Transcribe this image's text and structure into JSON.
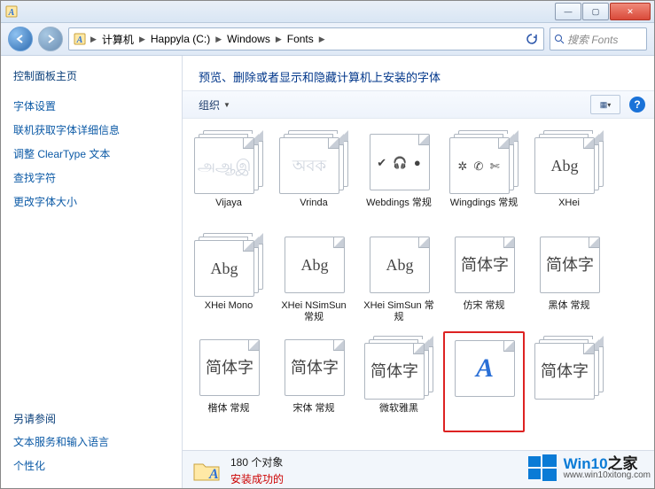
{
  "titlebar": {
    "icon_name": "fonts-icon"
  },
  "nav": {
    "back_icon": "chevron-left-icon",
    "forward_icon": "chevron-right-icon",
    "refresh_icon": "refresh-icon"
  },
  "breadcrumbs": {
    "items": [
      {
        "label": "计算机"
      },
      {
        "label": "Happyla (C:)"
      },
      {
        "label": "Windows"
      },
      {
        "label": "Fonts"
      }
    ]
  },
  "search": {
    "placeholder": "搜索 Fonts"
  },
  "sidebar": {
    "home_label": "控制面板主页",
    "links": [
      {
        "label": "字体设置"
      },
      {
        "label": "联机获取字体详细信息"
      },
      {
        "label": "调整 ClearType 文本"
      },
      {
        "label": "查找字符"
      },
      {
        "label": "更改字体大小"
      }
    ],
    "see_also_label": "另请参阅",
    "see_also": [
      {
        "label": "文本服务和输入语言"
      },
      {
        "label": "个性化"
      }
    ]
  },
  "main": {
    "heading": "预览、删除或者显示和隐藏计算机上安装的字体",
    "organize_label": "组织"
  },
  "fonts": [
    {
      "name": "Vijaya",
      "preview": "அஆஇ",
      "stack": true,
      "hidden": true
    },
    {
      "name": "Vrinda",
      "preview": "অবক",
      "stack": true,
      "hidden": true
    },
    {
      "name": "Webdings 常规",
      "preview": "✔ 🎧 ●",
      "stack": false,
      "dings": true
    },
    {
      "name": "Wingdings 常规",
      "preview": "✲ ✆ ✄",
      "stack": true,
      "dings": true
    },
    {
      "name": "XHei",
      "preview": "Abg",
      "stack": true
    },
    {
      "name": "XHei Mono",
      "preview": "Abg",
      "stack": true
    },
    {
      "name": "XHei NSimSun 常规",
      "preview": "Abg",
      "stack": false
    },
    {
      "name": "XHei SimSun 常规",
      "preview": "Abg",
      "stack": false
    },
    {
      "name": "仿宋 常规",
      "preview": "简体字",
      "stack": false
    },
    {
      "name": "黑体 常规",
      "preview": "简体字",
      "stack": false
    },
    {
      "name": "楷体 常规",
      "preview": "简体字",
      "stack": false
    },
    {
      "name": "宋体 常规",
      "preview": "简体字",
      "stack": false
    },
    {
      "name": "微软雅黑",
      "preview": "简体字",
      "stack": true
    },
    {
      "name": "",
      "preview": "A",
      "stack": false,
      "blueA": true,
      "selected": true
    },
    {
      "name": "",
      "preview": "简体字",
      "stack": true
    }
  ],
  "status": {
    "count_label": "180 个对象",
    "installed_label": "安装成功的"
  },
  "watermark": {
    "brand": "Win10",
    "suffix": "之家",
    "url": "www.win10xitong.com"
  }
}
